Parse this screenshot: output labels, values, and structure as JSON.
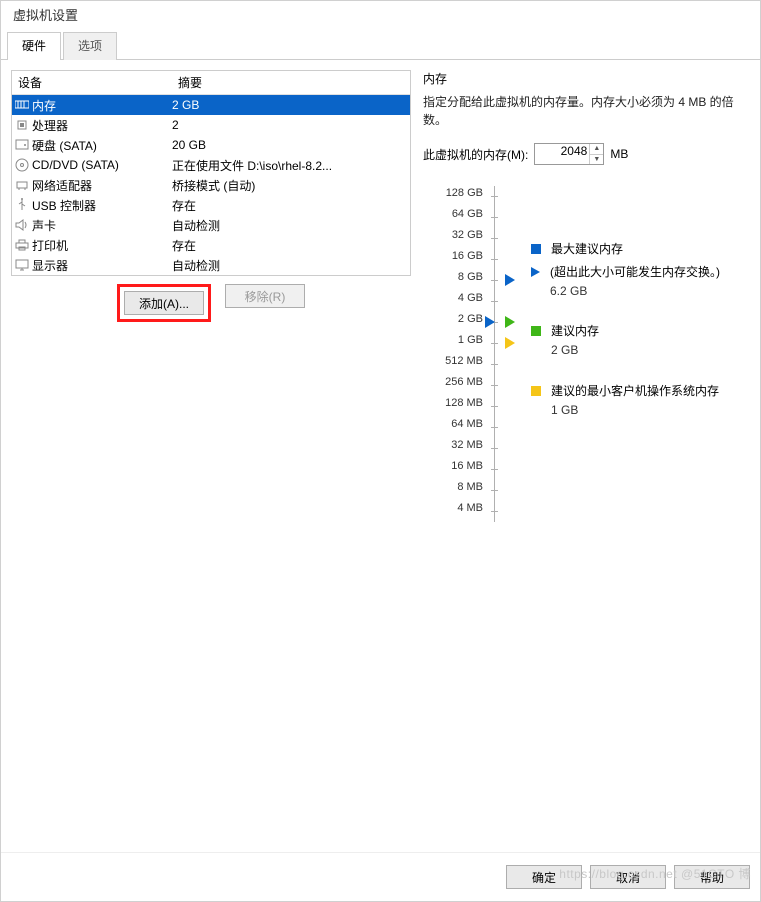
{
  "window": {
    "title": "虚拟机设置"
  },
  "tabs": {
    "hardware": "硬件",
    "options": "选项"
  },
  "columns": {
    "device": "设备",
    "summary": "摘要"
  },
  "hardware": [
    {
      "icon": "memory",
      "name": "内存",
      "summary": "2 GB",
      "selected": true
    },
    {
      "icon": "cpu",
      "name": "处理器",
      "summary": "2"
    },
    {
      "icon": "disk",
      "name": "硬盘 (SATA)",
      "summary": "20 GB"
    },
    {
      "icon": "cd",
      "name": "CD/DVD (SATA)",
      "summary": "正在使用文件 D:\\iso\\rhel-8.2..."
    },
    {
      "icon": "net",
      "name": "网络适配器",
      "summary": "桥接模式 (自动)"
    },
    {
      "icon": "usb",
      "name": "USB 控制器",
      "summary": "存在"
    },
    {
      "icon": "sound",
      "name": "声卡",
      "summary": "自动检测"
    },
    {
      "icon": "printer",
      "name": "打印机",
      "summary": "存在"
    },
    {
      "icon": "display",
      "name": "显示器",
      "summary": "自动检测"
    }
  ],
  "actions": {
    "add": "添加(A)...",
    "remove": "移除(R)"
  },
  "right": {
    "section": "内存",
    "desc": "指定分配给此虚拟机的内存量。内存大小必须为 4 MB 的倍数。",
    "label": "此虚拟机的内存(M):",
    "value": "2048",
    "unit": "MB"
  },
  "chart_data": {
    "type": "bar",
    "ticks": [
      "128 GB",
      "64 GB",
      "32 GB",
      "16 GB",
      "8 GB",
      "4 GB",
      "2 GB",
      "1 GB",
      "512 MB",
      "256 MB",
      "128 MB",
      "64 MB",
      "32 MB",
      "16 MB",
      "8 MB",
      "4 MB"
    ],
    "markers": {
      "current": {
        "tick_index": 6,
        "color": "#0a64c8",
        "side": "left"
      },
      "max_recommended": {
        "tick_index": 4,
        "color": "#0a64c8",
        "side": "right",
        "value": "6.2 GB"
      },
      "recommended": {
        "tick_index": 6,
        "color": "#3fb618",
        "side": "right",
        "value": "2 GB"
      },
      "min_guest": {
        "tick_index": 7,
        "color": "#f5c518",
        "side": "right",
        "value": "1 GB"
      }
    },
    "legend": {
      "max": {
        "color": "#0a64c8",
        "label": "最大建议内存",
        "sub": "(超出此大小可能发生内存交换。)",
        "value": "6.2 GB"
      },
      "rec": {
        "color": "#3fb618",
        "label": "建议内存",
        "value": "2 GB"
      },
      "min": {
        "color": "#f5c518",
        "label": "建议的最小客户机操作系统内存",
        "value": "1 GB"
      }
    }
  },
  "footer": {
    "ok": "确定",
    "cancel": "取消",
    "help": "帮助"
  },
  "watermark": "https://blog.csdn.net @51CTO 博"
}
